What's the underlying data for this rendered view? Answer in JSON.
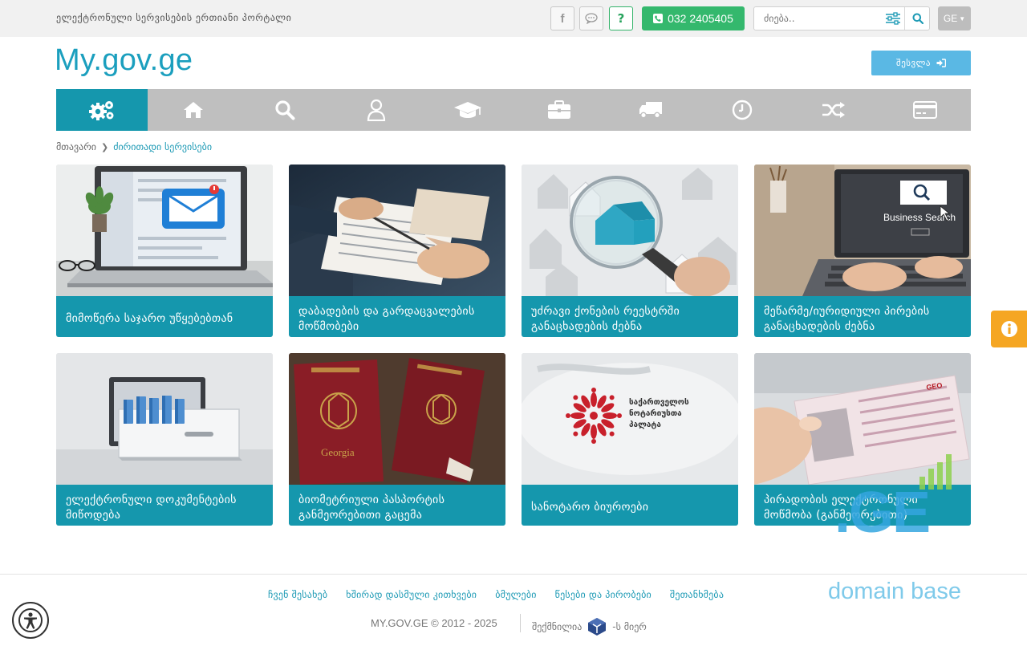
{
  "topbar": {
    "portal_title": "ელექტრონული სერვისების ერთიანი პორტალი",
    "help_label": "?",
    "phone": "032 2405405",
    "search_placeholder": "ძიება..",
    "language": "GE"
  },
  "header": {
    "logo": "My.gov.ge",
    "login_label": "შესვლა"
  },
  "nav": {
    "items": [
      {
        "icon": "gears-icon",
        "active": true
      },
      {
        "icon": "home-icon",
        "active": false
      },
      {
        "icon": "search-icon",
        "active": false
      },
      {
        "icon": "user-icon",
        "active": false
      },
      {
        "icon": "graduation-cap-icon",
        "active": false
      },
      {
        "icon": "briefcase-icon",
        "active": false
      },
      {
        "icon": "truck-icon",
        "active": false
      },
      {
        "icon": "clock-icon",
        "active": false
      },
      {
        "icon": "shuffle-icon",
        "active": false
      },
      {
        "icon": "credit-card-icon",
        "active": false
      }
    ]
  },
  "breadcrumb": {
    "home": "მთავარი",
    "current": "ძირითადი სერვისები"
  },
  "cards": [
    {
      "title": "მიმოწერა საჯარო უწყებებთან"
    },
    {
      "title": "დაბადების და გარდაცვალების მოწმობები"
    },
    {
      "title": "უძრავი ქონების რეესტრში განაცხადების ძებნა"
    },
    {
      "title": "მეწარმე/იურიდიული პირების განაცხადების ძებნა"
    },
    {
      "title": "ელექტრონული დოკუმენტების მიწოდება"
    },
    {
      "title": "ბიომეტრიული პასპორტის განმეორებითი გაცემა"
    },
    {
      "title": "სანოტარო ბიუროები"
    },
    {
      "title": "პირადობის ელექტრონული მოწმობა (განმეორებითი)"
    }
  ],
  "card_images": {
    "business_search_text": "Business Search",
    "passport_text": "Georgia",
    "notary_text_1": "საქართველოს",
    "notary_text_2": "ნოტარიუსთა",
    "notary_text_3": "პალატა",
    "id_card_text": "GEO"
  },
  "watermark": {
    "ge": ".GE",
    "base": "domain base"
  },
  "footer": {
    "links": [
      "ჩვენ შესახებ",
      "ხშირად დასმული კითხვები",
      "ბმულები",
      "წესები და პირობები",
      "შეთანხმება"
    ],
    "copyright": "MY.GOV.GE © 2012 - 2025",
    "made_by_prefix": "შექმნილია",
    "made_by_suffix": "-ს მიერ"
  },
  "colors": {
    "accent": "#1597ad",
    "nav_bg": "#bfbfbf",
    "phone_green": "#34b86d",
    "login_blue": "#5ab8e4",
    "info_orange": "#f5a623"
  }
}
